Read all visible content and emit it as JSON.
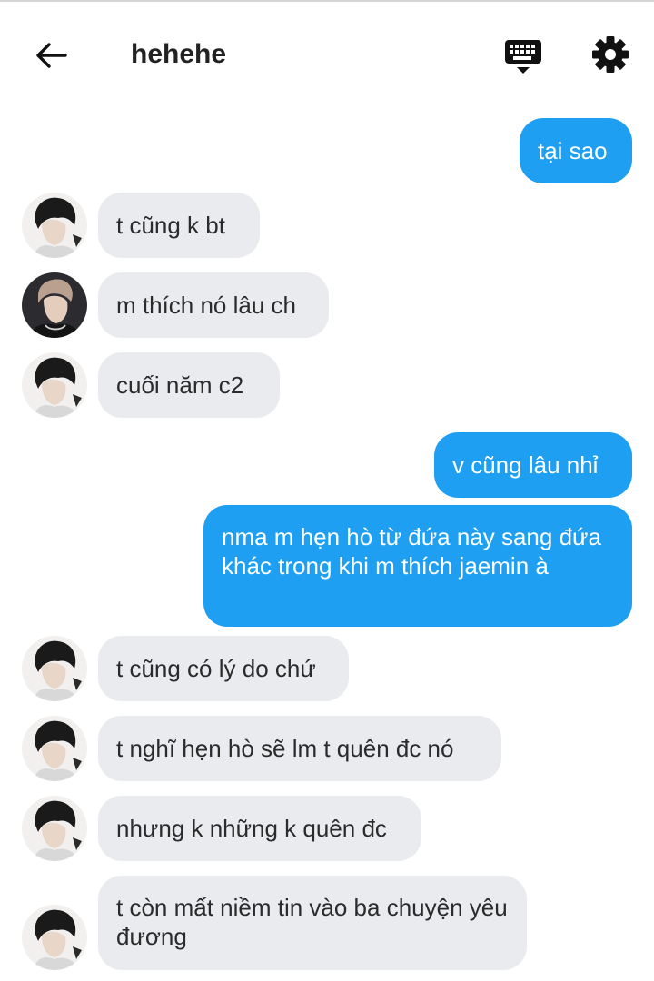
{
  "header": {
    "title": "hehehe",
    "icons": {
      "back": "arrow-left-icon",
      "keyboard": "keyboard-icon",
      "settings": "gear-icon"
    }
  },
  "colors": {
    "outgoing_bubble": "#1e9ff2",
    "incoming_bubble": "#e9ebef",
    "incoming_text": "#2b2b2b",
    "outgoing_text": "#ffffff"
  },
  "messages": [
    {
      "side": "out",
      "text": "tại sao"
    },
    {
      "side": "in",
      "avatar": "avatar-a",
      "text": "t cũng k bt"
    },
    {
      "side": "in",
      "avatar": "avatar-b",
      "text": "m thích nó lâu ch"
    },
    {
      "side": "in",
      "avatar": "avatar-a",
      "text": "cuối năm c2"
    },
    {
      "side": "out",
      "text": "v cũng lâu nhỉ"
    },
    {
      "side": "out",
      "text": "nma m hẹn hò từ đứa này sang đứa khác trong khi m thích jaemin à"
    },
    {
      "side": "in",
      "avatar": "avatar-a",
      "text": "t cũng có lý do chứ"
    },
    {
      "side": "in",
      "avatar": "avatar-a",
      "text": "t nghĩ hẹn hò sẽ lm t quên đc nó"
    },
    {
      "side": "in",
      "avatar": "avatar-a",
      "text": "nhưng k những k quên đc"
    },
    {
      "side": "in",
      "avatar": "avatar-a",
      "text": "t còn mất niềm tin vào ba chuyện yêu đương"
    }
  ]
}
